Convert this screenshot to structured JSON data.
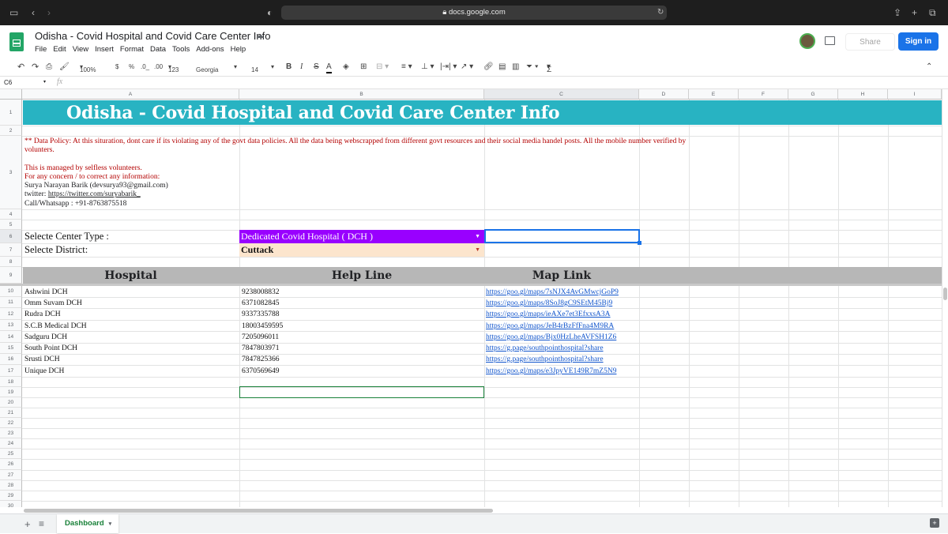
{
  "browser": {
    "url": "docs.google.com"
  },
  "header": {
    "doc_title": "Odisha - Covid Hospital and Covid Care Center Info",
    "menu": [
      "File",
      "Edit",
      "View",
      "Insert",
      "Format",
      "Data",
      "Tools",
      "Add-ons",
      "Help"
    ],
    "share_label": "Share",
    "signin_label": "Sign in"
  },
  "toolbar": {
    "zoom": "100%",
    "currency": "$",
    "percent": "%",
    "dec_less": ".0_",
    "dec_more": ".00",
    "format_more": "123",
    "font": "Georgia",
    "font_size": "14",
    "bold": "B",
    "italic": "I",
    "strike": "S",
    "text_color": "A",
    "sum": "Σ"
  },
  "formula_bar": {
    "cell_ref": "C6",
    "fx": "fx",
    "content": ""
  },
  "columns": [
    "A",
    "B",
    "C",
    "D",
    "E",
    "F",
    "G",
    "H",
    "I"
  ],
  "rows": [
    "1",
    "2",
    "3",
    "4",
    "5",
    "6",
    "7",
    "8",
    "9",
    "10",
    "11",
    "12",
    "13",
    "14",
    "15",
    "16",
    "17",
    "18",
    "19",
    "20",
    "21",
    "22",
    "23",
    "24",
    "25",
    "26",
    "27",
    "28",
    "29",
    "30"
  ],
  "sheet": {
    "title": "Odisha - Covid Hospital and Covid Care Center Info",
    "policy_line1": "** Data Policy: At this situration, dont care if its violating any of the govt data policies. All the data being webscrapped from different govt resources and their social media handel posts. All the mobile number verified by",
    "policy_line2": "volunters.",
    "managed": "This is managed by selfless volunteers.",
    "concern": "For any concern / to correct any information:",
    "contact_name": "Surya Narayan Barik (devsurya93@gmail.com)",
    "twitter_label": "twitter: ",
    "twitter_link": "https://twitter.com/suryabarik_",
    "call": "Call/Whatsapp : +91-8763875518",
    "center_type_label": "Selecte Center Type :",
    "center_type_value": "Dedicated Covid Hospital ( DCH )",
    "district_label": "Selecte District:",
    "district_value": "Cuttack",
    "table_headers": [
      "Hospital",
      "Help Line",
      "Map Link"
    ],
    "table_rows": [
      {
        "name": "Ashwini DCH",
        "phone": "9238008832",
        "link": "https://goo.gl/maps/7sNJX4AvGMwcjGoP9"
      },
      {
        "name": "Omm Suvam DCH",
        "phone": "6371082845",
        "link": "https://goo.gl/maps/8SoJ8gC9SEtM45Bj9"
      },
      {
        "name": "Rudra DCH",
        "phone": "9337335788",
        "link": "https://goo.gl/maps/ieAXe7et3EfxxsA3A"
      },
      {
        "name": "S.C.B Medical DCH",
        "phone": "18003459595",
        "link": "https://goo.gl/maps/JeB4rBzFfFna4M9RA"
      },
      {
        "name": "Sadguru DCH",
        "phone": "7205096011",
        "link": "https://goo.gl/maps/Bjx0HzLheAVFSH1Z6"
      },
      {
        "name": "South Point DCH",
        "phone": "7847803971",
        "link": "https://g.page/southpointhospital?share"
      },
      {
        "name": "Srusti DCH",
        "phone": "7847825366",
        "link": "https://g.page/southpointhospital?share"
      },
      {
        "name": "Unique DCH",
        "phone": "6370569649",
        "link": "https://goo.gl/maps/e3JpyVE149R7mZ5N9"
      }
    ]
  },
  "bottom": {
    "sheet_tab": "Dashboard"
  },
  "colors": {
    "title_band": "#28b3c2",
    "dch_purple": "#9900ff",
    "district_peach": "#fce5cd",
    "header_gray": "#b7b7b7",
    "policy_red": "#b30000",
    "link_blue": "#1155cc"
  }
}
